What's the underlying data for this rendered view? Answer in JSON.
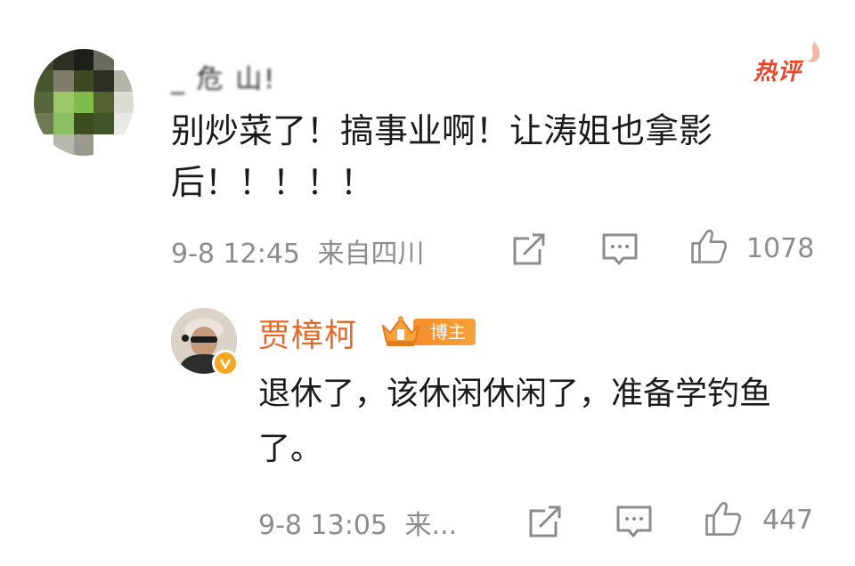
{
  "comment": {
    "username": "_ 危 山!",
    "hot_badge": "热评",
    "text": "别炒菜了！搞事业啊！让涛姐也拿影后！！！！！",
    "date_time": "9-8 12:45",
    "location": "来自四川",
    "likes": "1078"
  },
  "reply": {
    "username": "贾樟柯",
    "badge": "博主",
    "text": "退休了，该休闲休闲了，准备学钓鱼了。",
    "date_time": "9-8 13:05",
    "location": "来...",
    "likes": "447"
  },
  "colors": {
    "hot": "#e8452a",
    "reply_name": "#e36a2a",
    "badge": "#f58c2c",
    "meta": "#8c8c8c"
  },
  "icons": [
    "share-icon",
    "comment-icon",
    "like-icon",
    "hot-flame-icon",
    "crown-icon",
    "verified-icon"
  ]
}
